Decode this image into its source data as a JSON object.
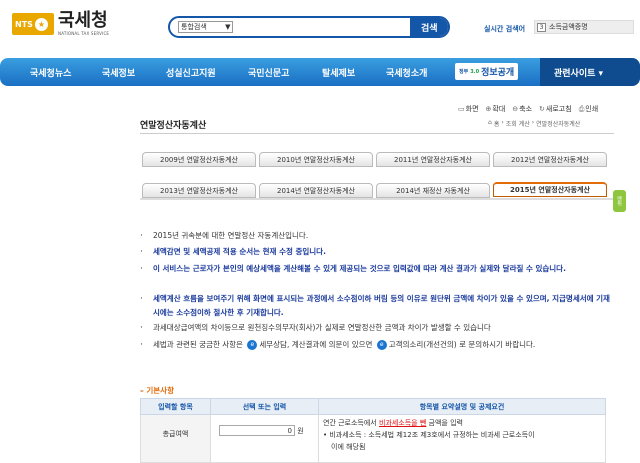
{
  "header": {
    "logo_badge": "NTS",
    "logo_seal": "★",
    "logo_title": "국세청",
    "logo_subtitle": "NATIONAL TAX SERVICE",
    "search_select": "통합검색",
    "search_button": "검색",
    "realtime_label": "실시간 검색어",
    "realtime_rank": "3",
    "realtime_term": "소득금액증명"
  },
  "nav": {
    "items": [
      "국세청뉴스",
      "국세정보",
      "성실신고지원",
      "국민신문고",
      "탈세제보",
      "국세청소개"
    ],
    "special_small": "정부",
    "special_logo": "3.0",
    "special_label": "정보공개",
    "related": "관련사이트 ▾"
  },
  "utility": {
    "print_view": "화면",
    "zoom_in": "확대",
    "zoom_out": "축소",
    "refresh": "새로고침",
    "print": "인쇄"
  },
  "page": {
    "title": "연말정산자동계산",
    "breadcrumb_home": "홈",
    "breadcrumb_1": "조회 계산",
    "breadcrumb_2": "연말정산자동계산",
    "side_tab": "맨위"
  },
  "tabs": [
    {
      "label": "2009년 연말정산자동계산"
    },
    {
      "label": "2010년 연말정산자동계산"
    },
    {
      "label": "2011년 연말정산자동계산"
    },
    {
      "label": "2012년 연말정산자동계산"
    },
    {
      "label": "2013년 연말정산자동계산"
    },
    {
      "label": "2014년 연말정산자동계산"
    },
    {
      "label": "2014년 재정산 자동계산"
    },
    {
      "label": "2015년 연말정산자동계산"
    }
  ],
  "active_tab_index": 7,
  "notes": [
    {
      "text": "2015년 귀속분에 대한 연말정산 자동계산입니다.",
      "style": "normal"
    },
    {
      "text": "세액감면 및 세액공제 적용 순서는 현재 수정 중입니다.",
      "style": "blue"
    },
    {
      "text": "이 서비스는 근로자가 본인의 예상세액을 계산해볼 수 있게 제공되는 것으로 입력값에 따라 계산 결과가 실제와 달라질 수 있습니다.",
      "style": "blue"
    },
    {
      "text": "세액계산 흐름을 보여주기 위해 화면에 표시되는 과정에서 소수점이하 버림 등의 이유로 원단위 금액에 차이가 있을 수 있으며, 지급명세서에 기재시에는 소수점이하 절사한 후 기재합니다.",
      "style": "blue"
    },
    {
      "text": "과세대상급여액의 차이등으로 원천징수의무자(회사)가 실제로 연말정산한 금액과 차이가 발생할 수 있습니다",
      "style": "normal"
    }
  ],
  "note_last": {
    "part1": "세법과 관련된 궁금한 사항은",
    "link1": "세무상담",
    "part2": ", 계산결과에 의문이 있으면",
    "link2": "고객의소리(개선건의)",
    "part3": "로 문의하시기 바랍니다."
  },
  "basic": {
    "title": "기본사항",
    "headers": [
      "입력할 항목",
      "선택 또는 입력",
      "항목별 요약설명 및 공제요건"
    ],
    "row_label": "총급여액",
    "row_value": "0",
    "row_unit": "원",
    "desc_1a": "연간 근로소득에서",
    "desc_1b": "비과세소득을 뺀",
    "desc_1c": "금액을 입력",
    "desc_2": "• 비과세소득 : 소득세법 제12조 제3호에서 규정하는 비과세 근로소득이",
    "desc_3": "이에 해당됨"
  }
}
